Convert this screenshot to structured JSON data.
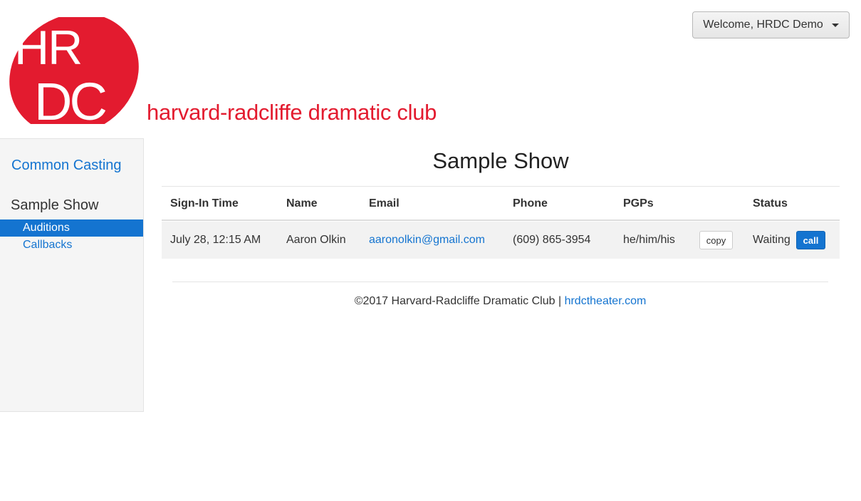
{
  "header": {
    "welcome_label": "Welcome, HRDC Demo",
    "logo_text": "HRDC",
    "brand_name": "harvard-radcliffe dramatic club",
    "brand_color": "#e31b2f"
  },
  "sidebar": {
    "common_casting_label": "Common Casting",
    "show_heading": "Sample Show",
    "items": [
      {
        "label": "Auditions",
        "active": true
      },
      {
        "label": "Callbacks",
        "active": false
      }
    ]
  },
  "main": {
    "title": "Sample Show",
    "columns": [
      "Sign-In Time",
      "Name",
      "Email",
      "Phone",
      "PGPs",
      "Status"
    ],
    "rows": [
      {
        "sign_in_time": "July 28, 12:15 AM",
        "name": "Aaron Olkin",
        "email": "aaronolkin@gmail.com",
        "phone": "(609) 865-3954",
        "pgps": "he/him/his",
        "copy_label": "copy",
        "status": "Waiting",
        "call_label": "call"
      }
    ]
  },
  "footer": {
    "copyright": "©2017 Harvard-Radcliffe Dramatic Club",
    "separator": "|",
    "link_label": "hrdctheater.com"
  },
  "colors": {
    "accent": "#1474d0",
    "sidebar_bg": "#f5f5f5",
    "row_bg": "#f2f2f2"
  }
}
